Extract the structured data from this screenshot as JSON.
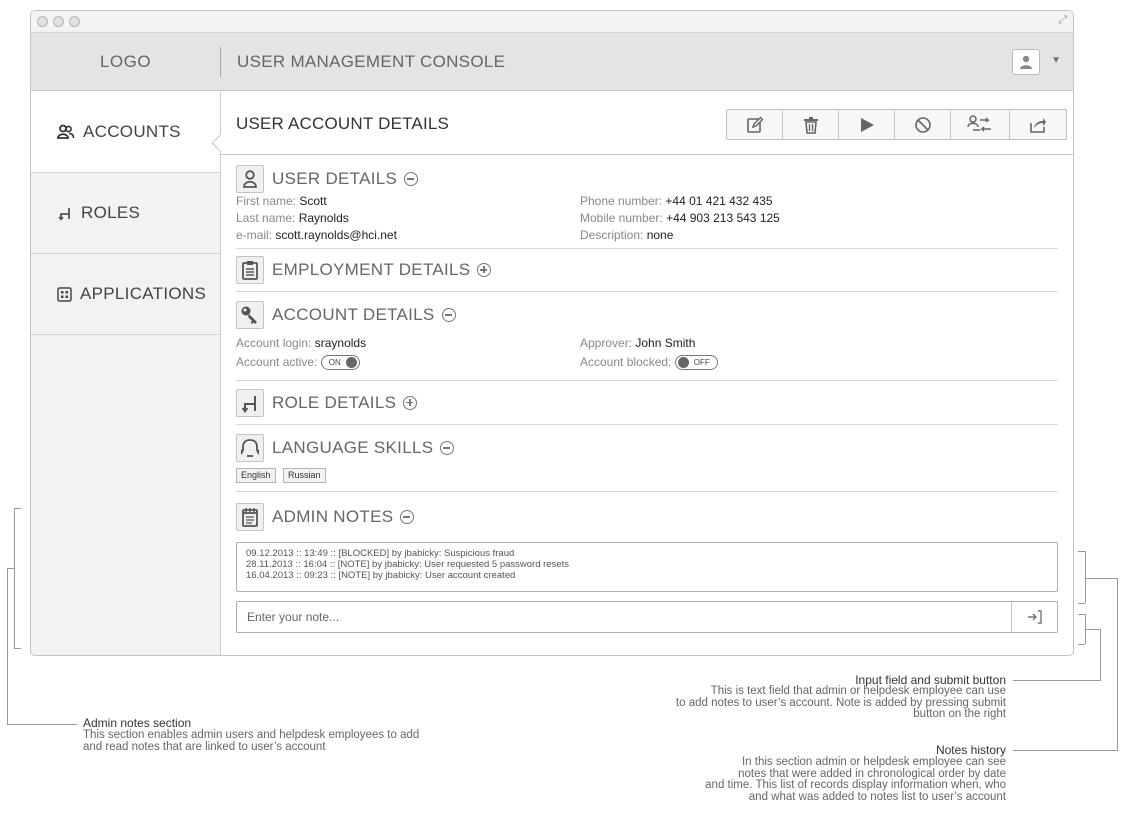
{
  "header": {
    "logo": "LOGO",
    "title": "USER MANAGEMENT CONSOLE"
  },
  "sidebar": {
    "items": [
      {
        "label": "ACCOUNTS",
        "icon": "users-icon",
        "active": true
      },
      {
        "label": "ROLES",
        "icon": "roles-icon",
        "active": false
      },
      {
        "label": "APPLICATIONS",
        "icon": "applications-icon",
        "active": false
      }
    ]
  },
  "main": {
    "title": "USER ACCOUNT DETAILS",
    "toolbar": [
      "edit-icon",
      "delete-icon",
      "play-icon",
      "block-icon",
      "transfer-icon",
      "export-icon"
    ]
  },
  "user_details": {
    "title": "USER DETAILS",
    "first_name_label": "First name:",
    "first_name": "Scott",
    "last_name_label": "Last name:",
    "last_name": "Raynolds",
    "email_label": "e-mail:",
    "email": "scott.raynolds@hci.net",
    "phone_label": "Phone number:",
    "phone": "+44 01 421 432 435",
    "mobile_label": "Mobile number:",
    "mobile": "+44 903 213 543 125",
    "description_label": "Description:",
    "description": "none"
  },
  "employment_details": {
    "title": "EMPLOYMENT DETAILS"
  },
  "account_details": {
    "title": "ACCOUNT DETAILS",
    "login_label": "Account login:",
    "login": "sraynolds",
    "active_label": "Account active:",
    "active_toggle": "ON",
    "approver_label": "Approver:",
    "approver": "John Smith",
    "blocked_label": "Account blocked:",
    "blocked_toggle": "OFF"
  },
  "role_details": {
    "title": "ROLE DETAILS"
  },
  "language_skills": {
    "title": "LANGUAGE SKILLS",
    "languages": [
      "English",
      "Russian"
    ]
  },
  "admin_notes": {
    "title": "ADMIN NOTES",
    "entries": [
      "09.12.2013  :: 13:49  :: [BLOCKED] by jbabicky: Suspicious fraud",
      "28.11.2013  :: 16:04  :: [NOTE] by jbabicky: User requested 5 password resets",
      "16.04.2013  :: 09:23 :: [NOTE] by jbabicky: User account created"
    ],
    "input_placeholder": "Enter your note..."
  },
  "annotations": {
    "input": {
      "title": "Input field and submit button",
      "lines": [
        "This is text field that admin or helpdesk employee can use",
        "to add notes to user’s account. Note is added by pressing submit",
        "button on the right"
      ]
    },
    "admin_section": {
      "title": "Admin notes section",
      "lines": [
        "This section enables admin users and helpdesk employees to add",
        "and read notes that are linked to user’s account"
      ]
    },
    "history": {
      "title": "Notes history",
      "lines": [
        "In this section admin or helpdesk employee can see",
        "notes that were added in chronological order by date",
        "and time. This list of records display information when, who",
        "and what was added to notes list to user’s account"
      ]
    }
  }
}
